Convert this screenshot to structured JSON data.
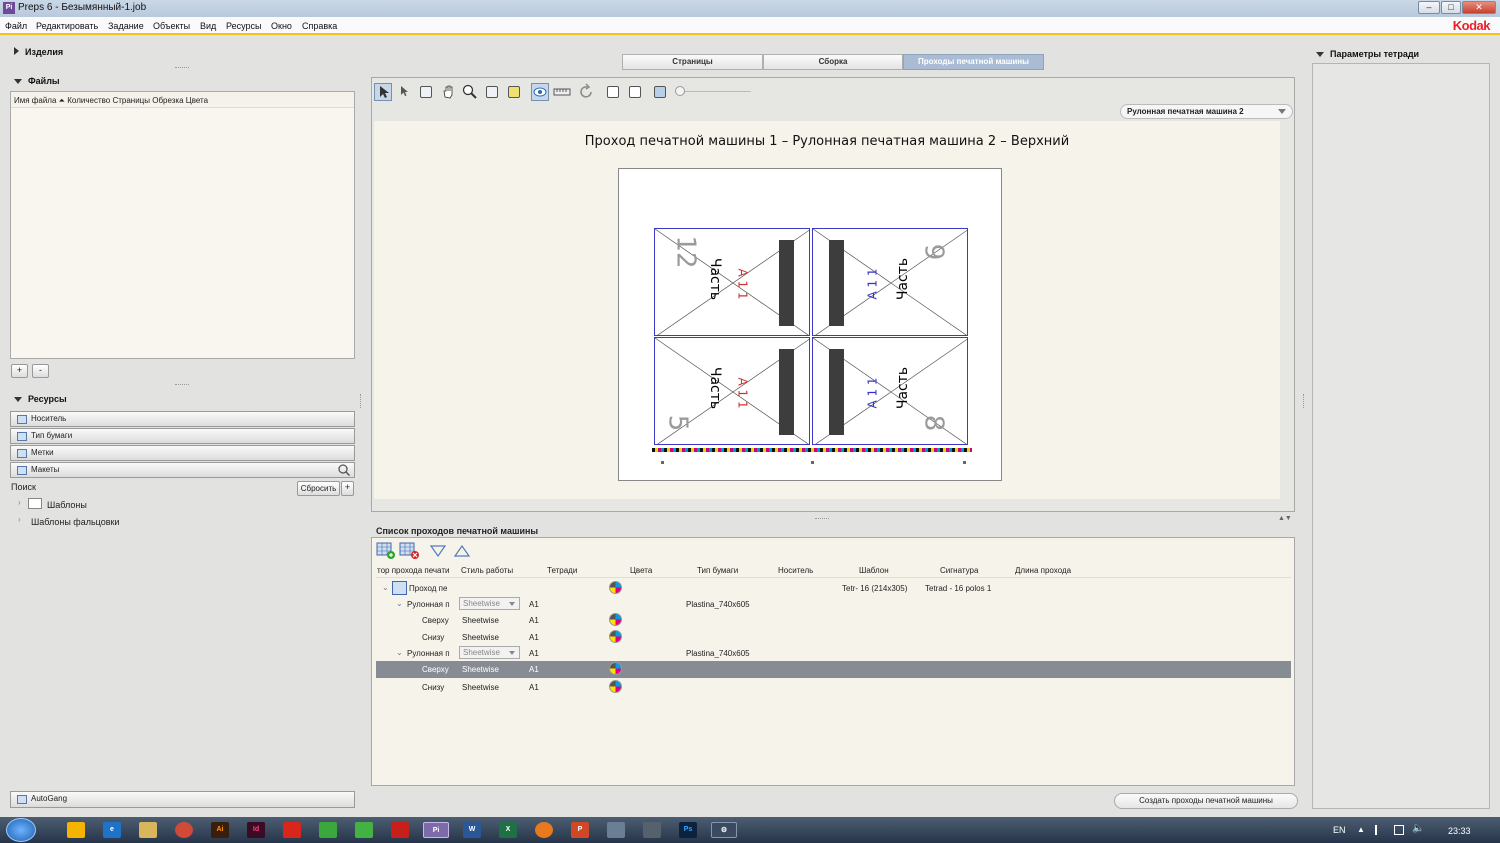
{
  "window": {
    "title": "Preps 6 - Безымянный-1.job",
    "app_icon": "Pi"
  },
  "window_controls": {
    "minimize": "–",
    "maximize": "□",
    "close": "✕"
  },
  "menu": [
    "Файл",
    "Редактировать",
    "Задание",
    "Объекты",
    "Вид",
    "Ресурсы",
    "Окно",
    "Справка"
  ],
  "brand": "Kodak",
  "left": {
    "products_title": "Изделия",
    "files_title": "Файлы",
    "files_header": "Имя файла ⏶ Количество Страницы Обрезка Цвета",
    "add_btn": "+",
    "remove_btn": "-",
    "resources_title": "Ресурсы",
    "resources": [
      "Носитель",
      "Тип бумаги",
      "Метки",
      "Макеты"
    ],
    "search_label": "Поиск",
    "reset_btn": "Сбросить",
    "plus_btn": "+",
    "tree": [
      "Шаблоны",
      "Шаблоны фальцовки"
    ],
    "autogang": "AutoGang"
  },
  "tabs": [
    "Страницы",
    "Сборка",
    "Проходы печатной машины"
  ],
  "press_dropdown": "Рулонная печатная машина 2",
  "sheet_title": "Проход печатной машины 1 – Рулонная печатная машина 2 – Верхний",
  "sheet": {
    "part_label": "Часть",
    "sig_label": "A 1 1",
    "pages": [
      "12",
      "9",
      "5",
      "8"
    ]
  },
  "list": {
    "title": "Список проходов печатной машины",
    "columns": [
      "тор прохода печати",
      "Стиль работы",
      "Тетради",
      "Цвета",
      "Тип бумаги",
      "Носитель",
      "Шаблон",
      "Сигнатура",
      "Длина прохода"
    ],
    "rows": [
      {
        "name": "Проход пе",
        "style": "",
        "sheets": "",
        "paper": "",
        "template": "Tetr- 16 (214x305)",
        "signature": "Tetrad - 16 polos 1"
      },
      {
        "name": "Рулонная п",
        "style": "Sheetwise",
        "sheets": "A1",
        "paper": "Plastina_740x605"
      },
      {
        "name": "Сверху",
        "style": "Sheetwise",
        "sheets": "A1"
      },
      {
        "name": "Снизу",
        "style": "Sheetwise",
        "sheets": "A1"
      },
      {
        "name": "Рулонная п",
        "style": "Sheetwise",
        "sheets": "A1",
        "paper": "Plastina_740x605"
      },
      {
        "name": "Сверху",
        "style": "Sheetwise",
        "sheets": "A1"
      },
      {
        "name": "Снизу",
        "style": "Sheetwise",
        "sheets": "A1"
      }
    ],
    "create_btn": "Создать проходы печатной машины"
  },
  "right": {
    "title": "Параметры тетради"
  },
  "taskbar": {
    "lang": "EN",
    "time": "23:33"
  }
}
